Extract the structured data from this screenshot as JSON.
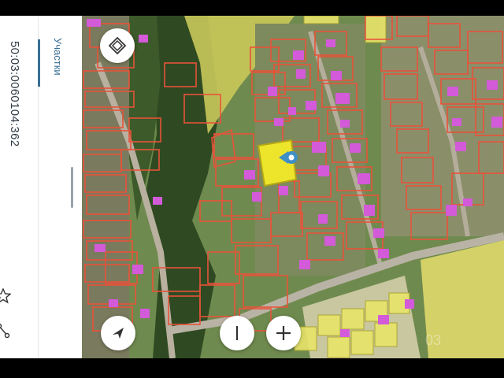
{
  "side_panel": {
    "cadastral_number": "50:03:0060104:362",
    "tab_label": "Участки"
  },
  "map": {
    "controls": {
      "layers_icon": "layers-diamond-icon",
      "compass_icon": "navigation-arrow-icon",
      "zoom_out_icon": "minus-icon",
      "zoom_in_icon": "plus-icon"
    },
    "selected_parcel_color": "#f2ea2a",
    "parcel_outline_color": "#e8533a",
    "building_color": "#d35ad8",
    "neighbor_parcel_fill": "#e8e46a",
    "marker_color": "#3e8fc6"
  },
  "watermark": "03"
}
